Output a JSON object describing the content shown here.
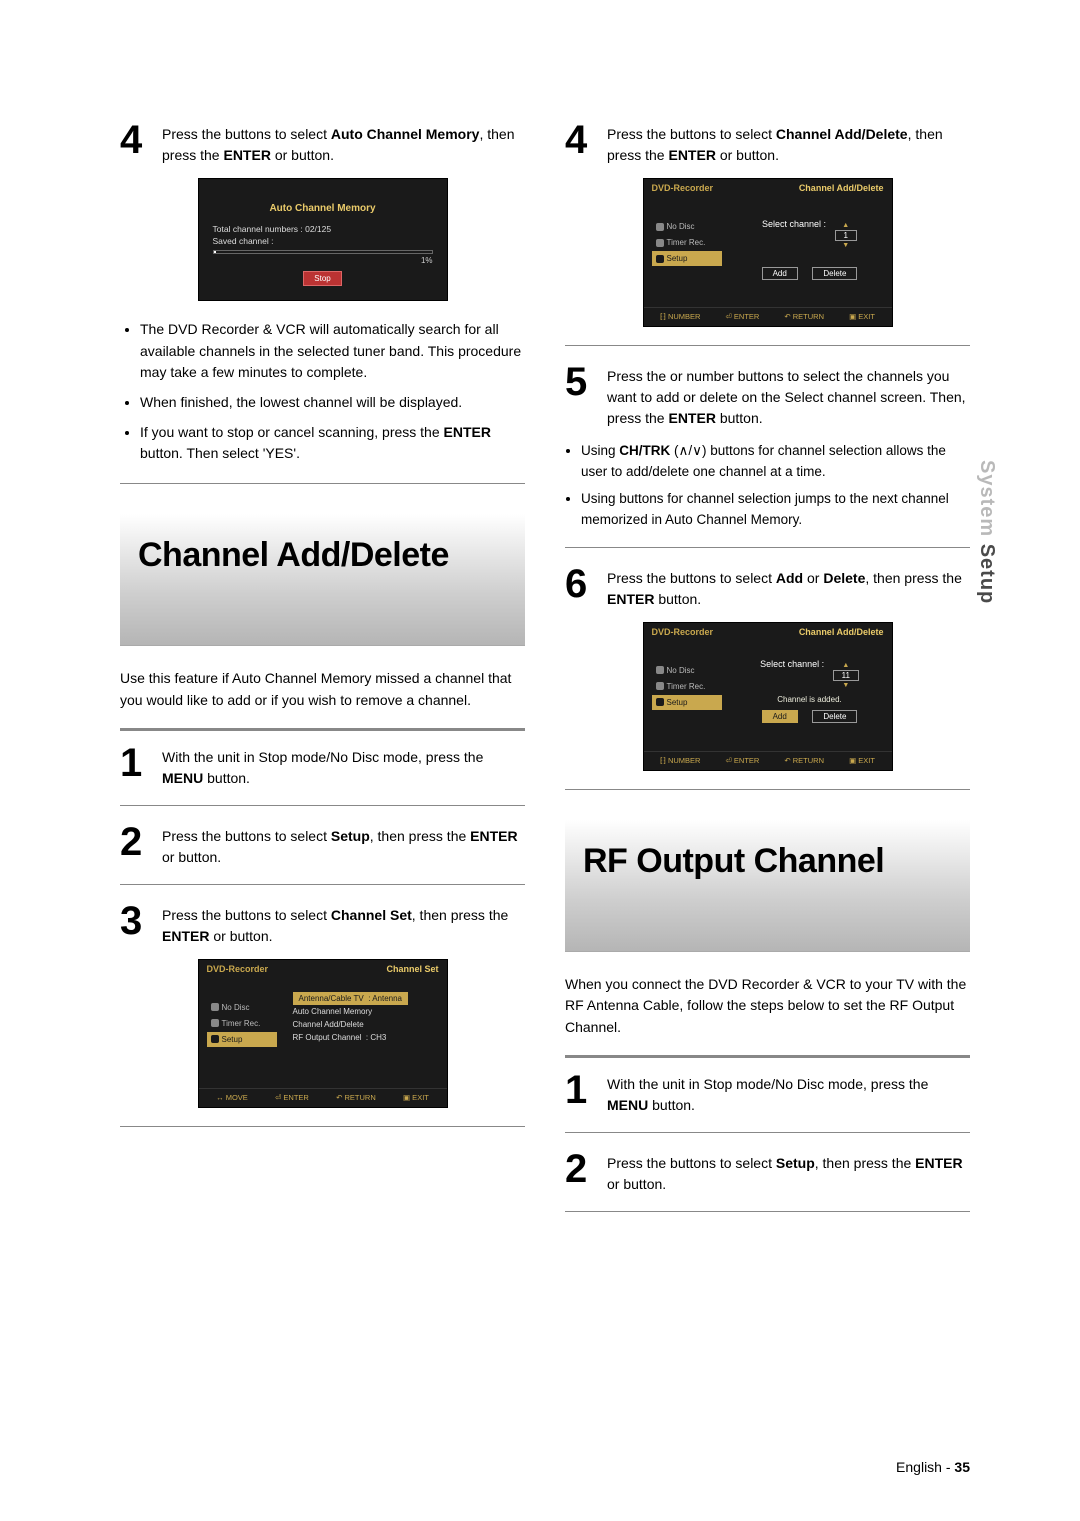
{
  "sideTab": {
    "light": "System ",
    "dark": "Setup"
  },
  "footer": {
    "lang": "English",
    "dash": " - ",
    "page": "35"
  },
  "left": {
    "step4": {
      "num": "4",
      "p1a": "Press the ",
      "p1b": " buttons to select ",
      "p1c": "Auto Channel Memory",
      "p1d": ", then press the ",
      "p1e": "ENTER",
      "p1f": " or ",
      "p1g": " button."
    },
    "osd1": {
      "title": "Auto Channel Memory",
      "line1": "Total channel numbers : 02/125",
      "line2": "Saved channel :",
      "pct": "1%",
      "stop": "Stop"
    },
    "bullets4": [
      "The DVD Recorder & VCR will automatically search for all available channels in the selected tuner band. This procedure may take a few minutes to complete.",
      "When finished, the lowest channel will be displayed.",
      {
        "a": "If you want to stop or cancel scanning, press the ",
        "b": "ENTER",
        "c": " button. Then select 'YES'."
      }
    ],
    "secAdd": {
      "title": "Channel Add/Delete"
    },
    "addIntro": "Use this feature if Auto Channel Memory missed a channel that you would like to add or if you wish to remove a channel.",
    "add1": {
      "num": "1",
      "a": "With the unit in Stop mode/No Disc mode, press the ",
      "b": "MENU",
      "c": " button."
    },
    "add2": {
      "num": "2",
      "a": "Press the ",
      "b": " buttons to select ",
      "c": "Setup",
      "d": ", then press the ",
      "e": "ENTER",
      "f": " or ",
      "g": " button."
    },
    "add3": {
      "num": "3",
      "a": "Press the ",
      "b": " buttons to select ",
      "c": "Channel Set",
      "d": ", then press the ",
      "e": "ENTER",
      "f": " or ",
      "g": " button."
    },
    "osd2": {
      "headL": "DVD-Recorder",
      "headR": "Channel Set",
      "side": [
        "No Disc",
        "Timer Rec.",
        "Setup"
      ],
      "rows": [
        {
          "k": "Antenna/Cable TV",
          "v": ": Antenna",
          "hl": true
        },
        {
          "k": "Auto Channel Memory",
          "v": ""
        },
        {
          "k": "Channel Add/Delete",
          "v": ""
        },
        {
          "k": "RF Output Channel",
          "v": ": CH3"
        }
      ],
      "foot": [
        "↔ MOVE",
        "⏎ ENTER",
        "↶ RETURN",
        "▣ EXIT"
      ]
    }
  },
  "right": {
    "step4": {
      "num": "4",
      "a": "Press the ",
      "b": " buttons to select ",
      "c": "Channel Add/Delete",
      "d": ", then press the ",
      "e": "ENTER",
      "f": " or ",
      "g": " button."
    },
    "osd3": {
      "headL": "DVD-Recorder",
      "headR": "Channel Add/Delete",
      "side": [
        "No Disc",
        "Timer Rec.",
        "Setup"
      ],
      "selLabel": "Select channel   :",
      "selVal": "1",
      "btnAdd": "Add",
      "btnDel": "Delete",
      "foot": [
        "⁅⁆ NUMBER",
        "⏎ ENTER",
        "↶ RETURN",
        "▣ EXIT"
      ]
    },
    "step5": {
      "num": "5",
      "a": "Press the ",
      "b": " or number buttons to select the channels you want to add or delete on the Select channel screen. Then, press the ",
      "c": "ENTER",
      "d": " button."
    },
    "sub5": [
      {
        "a": "Using ",
        "b": "CH/TRK",
        "c": " (∧/∨) buttons for channel selection allows the user to add/delete one channel at a time."
      },
      {
        "a": "Using ",
        "b": "",
        "c": " buttons for channel selection jumps to the next channel memorized in Auto Channel Memory."
      }
    ],
    "step6": {
      "num": "6",
      "a": "Press the ",
      "b": " buttons to select ",
      "c": "Add",
      "d": " or ",
      "e": "Delete",
      "f": ", then press the ",
      "g": "ENTER",
      "h": " button."
    },
    "osd4": {
      "headL": "DVD-Recorder",
      "headR": "Channel Add/Delete",
      "side": [
        "No Disc",
        "Timer Rec.",
        "Setup"
      ],
      "selLabel": "Select channel   :",
      "selVal": "11",
      "msg": "Channel is added.",
      "btnAdd": "Add",
      "btnDel": "Delete",
      "foot": [
        "⁅⁆ NUMBER",
        "⏎ ENTER",
        "↶ RETURN",
        "▣ EXIT"
      ]
    },
    "secRF": {
      "title": "RF Output Channel"
    },
    "rfIntro": "When you connect the DVD Recorder & VCR to your TV with the RF Antenna Cable, follow the steps below to set the RF Output Channel.",
    "rf1": {
      "num": "1",
      "a": "With the unit in Stop mode/No Disc mode, press the ",
      "b": "MENU",
      "c": " button."
    },
    "rf2": {
      "num": "2",
      "a": "Press the ",
      "b": " buttons to select ",
      "c": "Setup",
      "d": ", then press the ",
      "e": "ENTER",
      "f": " or ",
      "g": " button."
    }
  }
}
